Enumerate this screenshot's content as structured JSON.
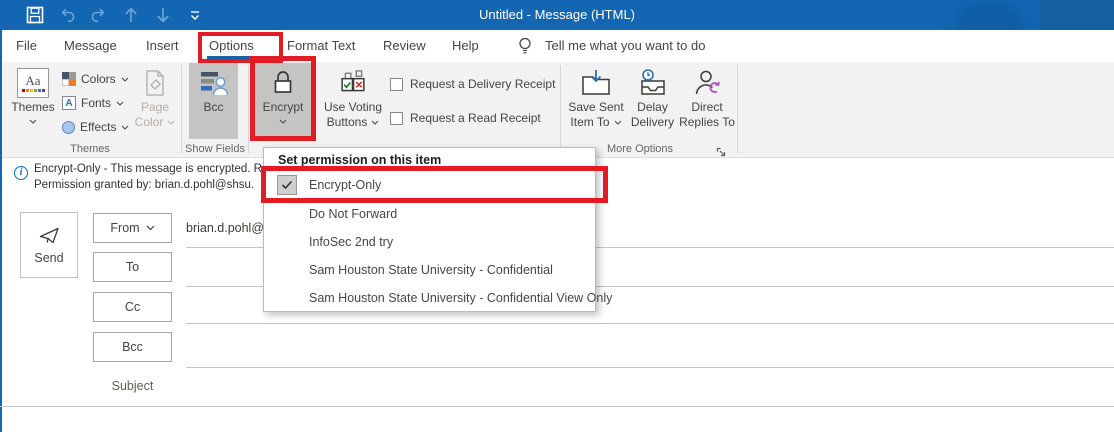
{
  "titlebar": {
    "title": "Untitled  -  Message (HTML)",
    "icons": [
      "save",
      "undo",
      "redo",
      "move-up",
      "move-down",
      "customize-quick-access"
    ]
  },
  "menubar": {
    "tabs": [
      {
        "label": "File"
      },
      {
        "label": "Message"
      },
      {
        "label": "Insert"
      },
      {
        "label": "Options",
        "selected": true
      },
      {
        "label": "Format Text"
      },
      {
        "label": "Review"
      },
      {
        "label": "Help"
      }
    ],
    "tell_me": "Tell me what you want to do"
  },
  "ribbon": {
    "themes_group_label": "Themes",
    "themes_button": "Themes",
    "colors": "Colors",
    "fonts": "Fonts",
    "effects": "Effects",
    "page_color_l1": "Page",
    "page_color_l2": "Color",
    "show_fields_group_label": "Show Fields",
    "bcc_button": "Bcc",
    "encrypt_button": "Encrypt",
    "voting_l1": "Use Voting",
    "voting_l2": "Buttons",
    "delivery_receipt": "Request a Delivery Receipt",
    "read_receipt": "Request a Read Receipt",
    "save_sent_l1": "Save Sent",
    "save_sent_l2": "Item To",
    "delay_l1": "Delay",
    "delay_l2": "Delivery",
    "direct_l1": "Direct",
    "direct_l2": "Replies To",
    "more_options_group_label": "More Options"
  },
  "infobar": {
    "line1": "Encrypt-Only - This message is encrypted. R",
    "line2": "Permission granted by: brian.d.pohl@shsu."
  },
  "compose": {
    "send_button": "Send",
    "from_button": "From",
    "from_value": "brian.d.pohl@",
    "to_button": "To",
    "cc_button": "Cc",
    "bcc_button": "Bcc",
    "subject_label": "Subject"
  },
  "dropdown": {
    "header": "Set permission on this item",
    "items": [
      {
        "label": "Encrypt-Only",
        "checked": true
      },
      {
        "label": "Do Not Forward",
        "checked": false
      },
      {
        "label": "InfoSec 2nd try",
        "checked": false
      },
      {
        "label": "Sam Houston State University - Confidential",
        "checked": false
      },
      {
        "label": "Sam Houston State University - Confidential View Only",
        "checked": false
      }
    ]
  },
  "colors": {
    "titlebar_blue": "#1266b2",
    "accent_blue": "#1464ac",
    "annotation_red": "#e11c24",
    "pressed_gray": "#c5c4c2",
    "ribbon_bg": "#f3f2f2"
  }
}
